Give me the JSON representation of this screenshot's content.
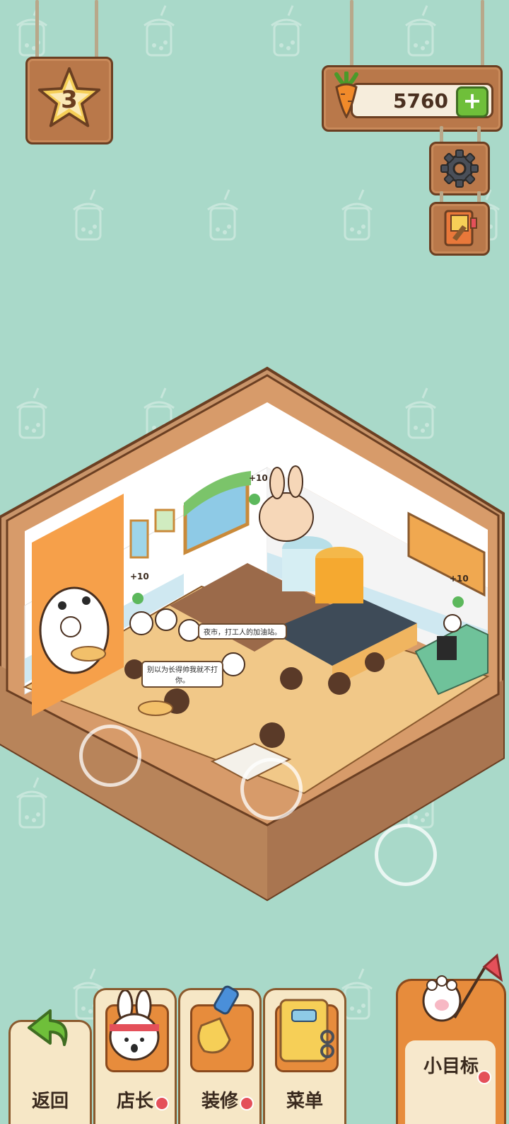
{
  "hud": {
    "level": "3",
    "currency_value": "5760",
    "currency_plus": "+",
    "currency_icon": "carrot-icon",
    "settings_icon": "gear-icon",
    "book_icon": "notebook-icon"
  },
  "scene": {
    "speech_1": "夜市，打工人的加油站。",
    "speech_2": "别以为长得帅我就不打你。",
    "reward_1": "+10",
    "reward_2": "+10",
    "reward_3": "+10"
  },
  "nav": {
    "back_label": "返回",
    "manager_label": "店长",
    "decorate_label": "装修",
    "menu_label": "菜单",
    "goal_label": "小目标"
  },
  "colors": {
    "background": "#a9d9c9",
    "wood": "#b9784a",
    "accent_green": "#6fbf3a",
    "notify_red": "#e4505a"
  }
}
